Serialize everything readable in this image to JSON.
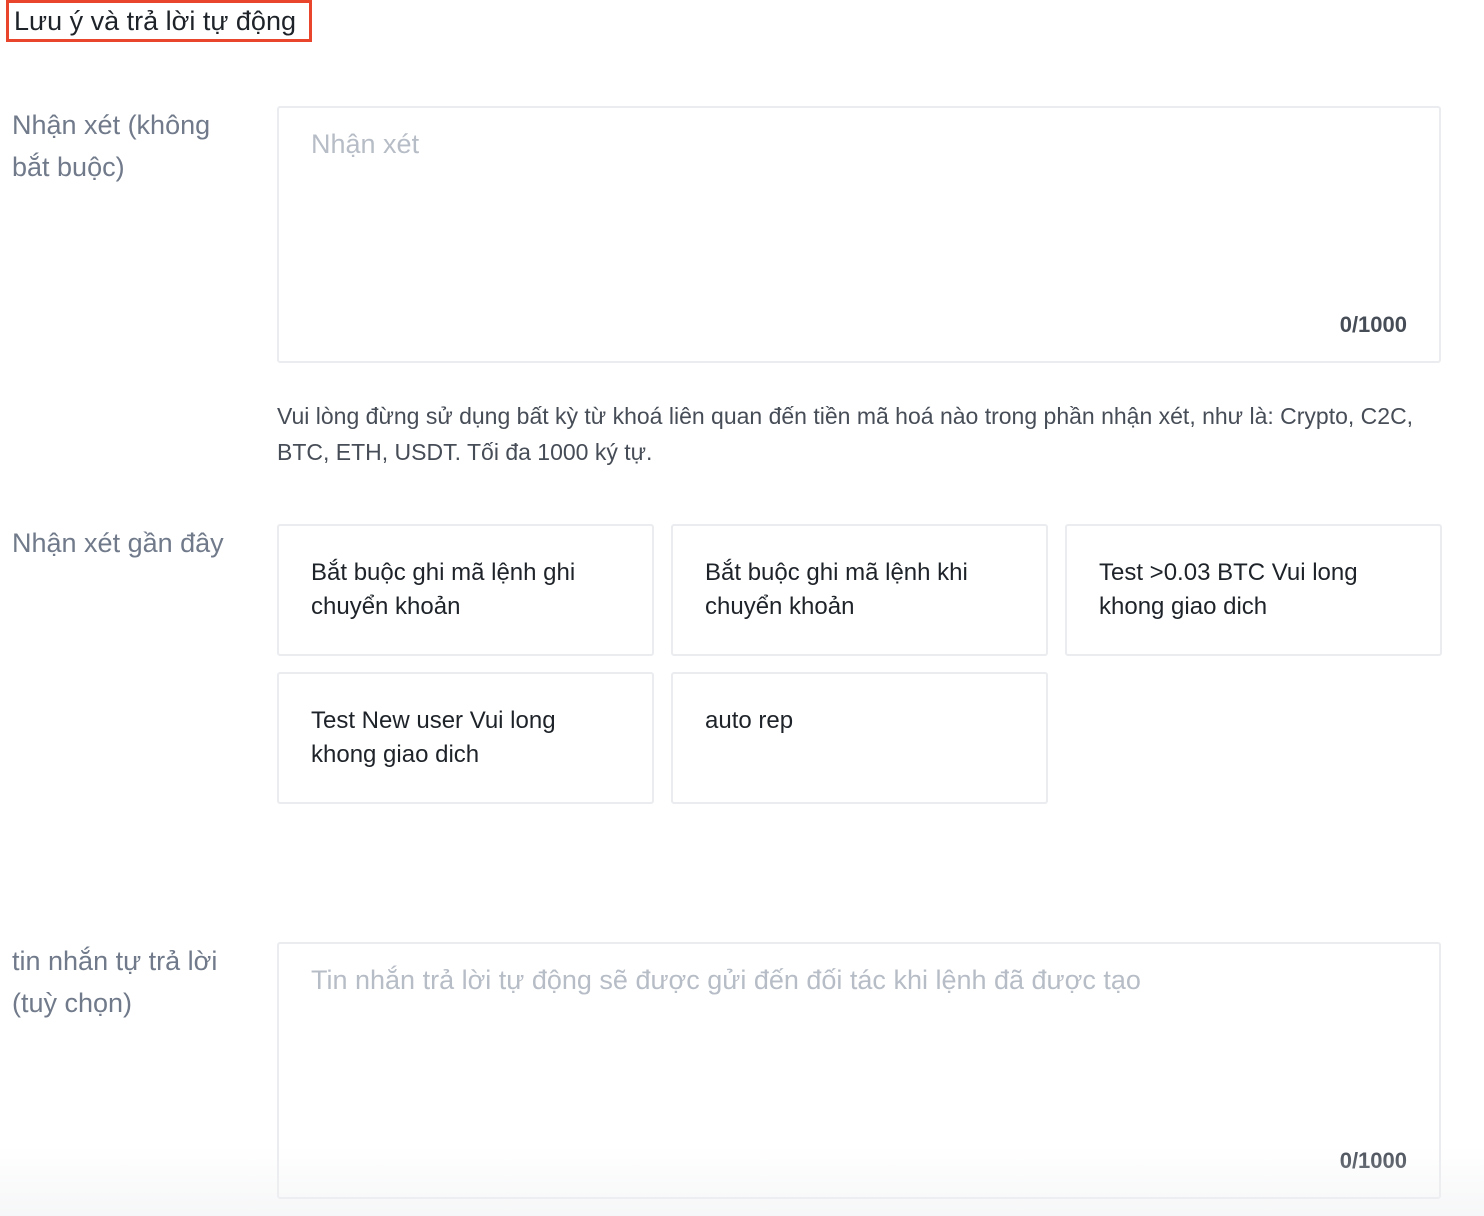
{
  "section": {
    "title": "Lưu ý và trả lời tự động"
  },
  "remarks": {
    "label": "Nhận xét (không bắt buộc)",
    "placeholder": "Nhận xét",
    "counter": "0/1000",
    "hint": "Vui lòng đừng sử dụng bất kỳ từ khoá liên quan đến tiền mã hoá nào trong phần nhận xét, như là: Crypto, C2C, BTC, ETH, USDT. Tối đa 1000 ký tự."
  },
  "recent_remarks": {
    "label": "Nhận xét gần đây",
    "items": [
      {
        "text": "Bắt buộc ghi mã lệnh ghi chuyển khoản"
      },
      {
        "text": "Bắt buộc ghi mã lệnh khi chuyển khoản"
      },
      {
        "text": "Test >0.03 BTC Vui long khong giao dich"
      },
      {
        "text": "Test New user Vui long khong giao dich"
      },
      {
        "text": "auto rep"
      }
    ]
  },
  "auto_reply": {
    "label": "tin nhắn tự trả lời (tuỳ chọn)",
    "placeholder": "Tin nhắn trả lời tự động sẽ được gửi đến đối tác khi lệnh đã được tạo",
    "counter": "0/1000"
  }
}
